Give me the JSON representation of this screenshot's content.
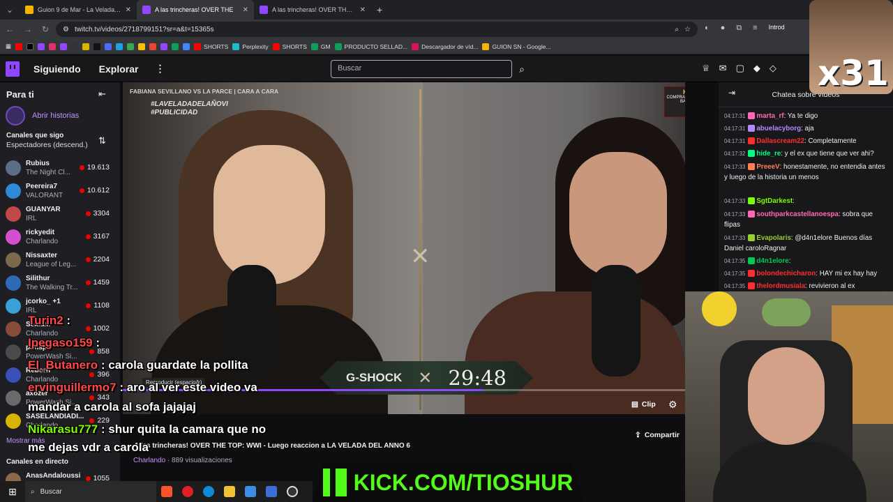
{
  "browser": {
    "tabs": [
      {
        "title": "Guion 9 de Mar - La Velada - P",
        "color": "#f4b400",
        "active": false
      },
      {
        "title": "A las trincheras! OVER THE",
        "color": "#9147ff",
        "active": true
      },
      {
        "title": "A las trincheras! OVER THE TOP",
        "color": "#9147ff",
        "active": false
      }
    ],
    "new_tab": "+",
    "url": "twitch.tv/videos/2718799151?sr=a&t=15365s",
    "bookmarks": [
      "SHORTS",
      "Perplexity",
      "SHORTS",
      "GM",
      "PRODUCTO SELLAD...",
      "Descargador de víd...",
      "GUION SN - Google..."
    ],
    "profile_label": "Introd"
  },
  "twitch": {
    "nav": {
      "following": "Siguiendo",
      "browse": "Explorar",
      "more": "⋮",
      "search_placeholder": "Buscar"
    },
    "sidebar": {
      "title": "Para ti",
      "open_history": "Abrir historias",
      "followed_title": "Canales que sigo",
      "followed_sort": "Espectadores (descend.)",
      "channels": [
        {
          "name": "Rubius",
          "game": "The Night Cl...",
          "viewers": "19.613",
          "color": "#5a6e88"
        },
        {
          "name": "Peereira7",
          "game": "VALORANT",
          "viewers": "10.612",
          "color": "#2c8ad6"
        },
        {
          "name": "GUANYAR",
          "game": "IRL",
          "viewers": "3304",
          "color": "#c04848"
        },
        {
          "name": "rickyedit",
          "game": "Charlando",
          "viewers": "3167",
          "color": "#d44fd0"
        },
        {
          "name": "Nissaxter",
          "game": "League of Leg...",
          "viewers": "2204",
          "color": "#7a6a4a"
        },
        {
          "name": "Silithur",
          "game": "The Walking Tr...",
          "viewers": "1459",
          "color": "#2d6bb8"
        },
        {
          "name": "jcorko_ +1",
          "game": "IRL",
          "viewers": "1108",
          "color": "#3aa0d8"
        },
        {
          "name": "Sexiam",
          "game": "Charlando",
          "viewers": "1002",
          "color": "#8a4c3a"
        },
        {
          "name": "ponspol",
          "game": "PowerWash Si...",
          "viewers": "858",
          "color": "#4a4a4a"
        },
        {
          "name": "Reborn",
          "game": "Charlando",
          "viewers": "396",
          "color": "#3a4fb8"
        },
        {
          "name": "axozer",
          "game": "PowerWash Si...",
          "viewers": "343",
          "color": "#6a6a6a"
        },
        {
          "name": "SASELANDIADI...",
          "game": "Charlando",
          "viewers": "229",
          "color": "#d8b400"
        }
      ],
      "show_more": "Mostrar más",
      "live_title": "Canales en directo",
      "live_channels": [
        {
          "name": "AnasAndaloussi",
          "viewers": "1055",
          "color": "#8a6a4a"
        }
      ]
    },
    "video": {
      "top_title": "FABIANA SEVILLANO VS LA PARCE | CARA A CARA",
      "hashtag1": "#LAVELADADELAÑOVI",
      "hashtag2": "#PUBLICIDAD",
      "corner_brand": "K&G",
      "corner_text": "COMPRA JUEGOS MÁS BARATOS",
      "scoreboard_brand": "G-SHOCK",
      "scoreboard_time": "29:48",
      "tooltip": "Reproducir (espacio/k)",
      "progress": 0.64,
      "clip_label": "Clip"
    },
    "info": {
      "title": "A las trincheras! OVER THE TOP: WWI - Luego reaccion a LA VELADA DEL ANNO 6",
      "category": "Charlando",
      "views": "889 visualizaciones",
      "share_label": "Compartir"
    },
    "chat": {
      "header": "Chatea sobre vídeos",
      "messages": [
        {
          "time": "04:17:31",
          "user": "marta_rf",
          "text": "Ya te digo",
          "color": "#ff69b4"
        },
        {
          "time": "04:17:31",
          "user": "abuelacyborg",
          "text": "aja",
          "color": "#b18cff"
        },
        {
          "time": "04:17:31",
          "user": "Dallascream22",
          "text": "Completamente",
          "color": "#ff2d2d"
        },
        {
          "time": "04:17:32",
          "user": "hide_re",
          "text": "y el ex que tiene que ver ahi?",
          "color": "#00ff7f"
        },
        {
          "time": "04:17:33",
          "user": "PreeeV",
          "text": "honestamente, no entendia antes y luego de la historia un menos",
          "color": "#ff7f50"
        },
        {
          "time": "04:17:33",
          "user": "SgtDarkest",
          "text": "",
          "color": "#7cfc00"
        },
        {
          "time": "04:17:33",
          "user": "southparkcastellanoespa",
          "text": "sobra que flipas",
          "color": "#ff69b4"
        },
        {
          "time": "04:17:33",
          "user": "Evapolaris",
          "text": "@d4n1elore Buenos días Daniel caroloRagnar",
          "color": "#9acd32"
        },
        {
          "time": "04:17:35",
          "user": "d4n1elore",
          "text": "",
          "color": "#00c853"
        },
        {
          "time": "04:17:35",
          "user": "bolondechicharon",
          "text": "HAY mi ex hay hay",
          "color": "#ff2d2d"
        },
        {
          "time": "04:17:35",
          "user": "thelordmusiala",
          "text": "revivieron al ex",
          "color": "#ff2d2d"
        }
      ]
    }
  },
  "overlay_chat": [
    {
      "user": "Turin2",
      "text": ":",
      "color": "#ff4848"
    },
    {
      "user": "Ipegaso159",
      "text": ":",
      "color": "#ff4848"
    },
    {
      "user": "El_Butanero",
      "text": ": carola guardate la pollita",
      "color": "#ff4848"
    },
    {
      "user": "ervinguillermo7",
      "text": ": aro al ver este video va",
      "color": "#ff4848"
    },
    {
      "user": "",
      "text": "mandar a carola al sofa jajajaj",
      "color": "#ffffff"
    },
    {
      "user": "Nikarasu777",
      "text": ": shur quita la camara que no",
      "color": "#7cfc00"
    },
    {
      "user": "",
      "text": "me dejas vdr a carola",
      "color": "#ffffff"
    }
  ],
  "kick_banner": "KICK.COM/TIOSHUR",
  "sub_counter": "x31",
  "taskbar": {
    "search_label": "Buscar"
  }
}
